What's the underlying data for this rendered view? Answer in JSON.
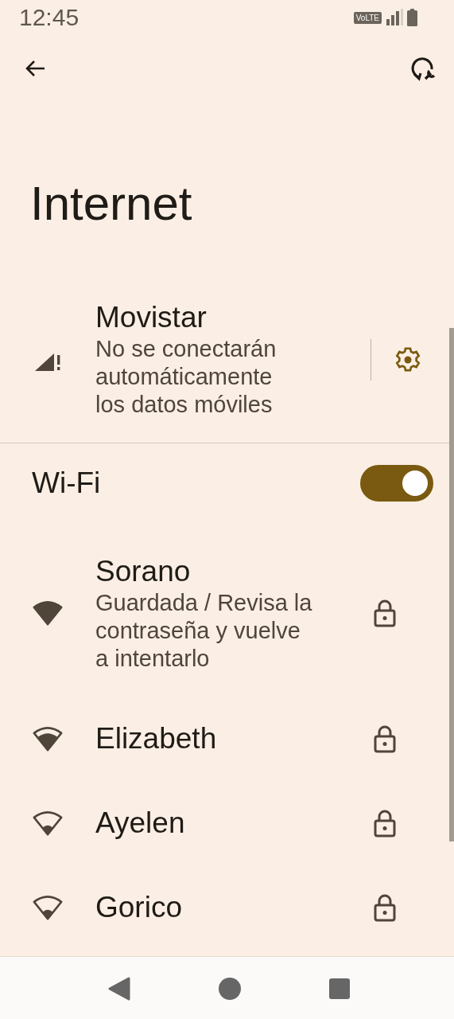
{
  "status_bar": {
    "time": "12:45",
    "volte_badge": "VoLTE"
  },
  "title": "Internet",
  "mobile": {
    "name": "Movistar",
    "status": "No se conectarán automáticamente los datos móviles"
  },
  "wifi": {
    "label": "Wi-Fi",
    "on": true
  },
  "networks": [
    {
      "name": "Sorano",
      "status": "Guardada / Revisa la contraseña y vuelve a intentarlo",
      "kind": "full",
      "locked": true
    },
    {
      "name": "Elizabeth",
      "kind": "good",
      "locked": true
    },
    {
      "name": "Ayelen",
      "kind": "weak",
      "locked": true
    },
    {
      "name": "Gorico",
      "kind": "weak",
      "locked": true
    }
  ]
}
